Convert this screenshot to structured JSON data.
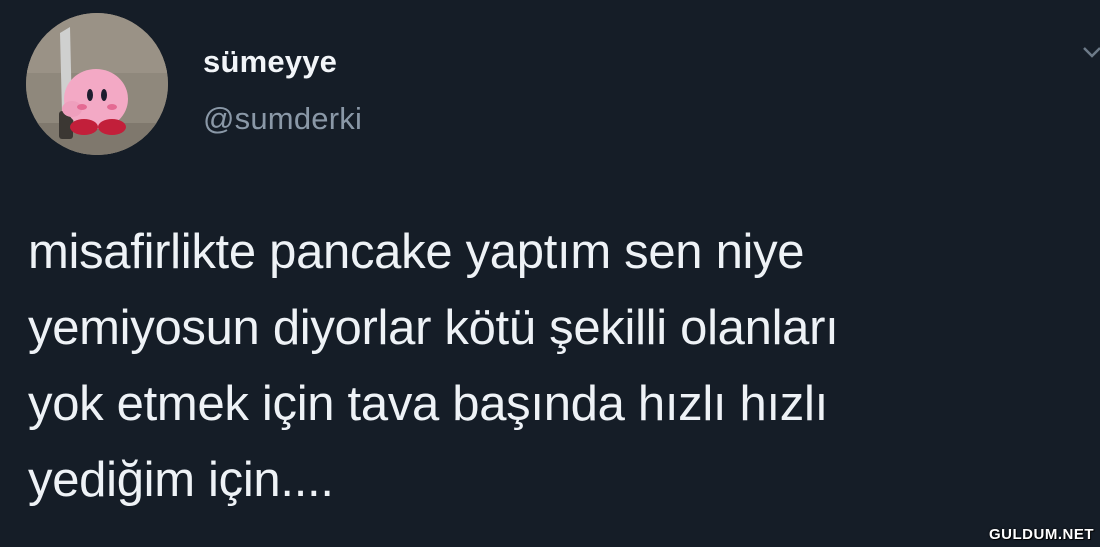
{
  "tweet": {
    "display_name": "sümeyye",
    "handle": "@sumderki",
    "text": "misafirlikte pancake yaptım sen niye\nyemiyosun diyorlar kötü şekilli olanları\nyok etmek için tava başında hızlı hızlı\nyediğim için...."
  },
  "avatar": {
    "description_icon": "kirby-plush-knife-avatar"
  },
  "watermark": {
    "text": "GULDUM.NET"
  },
  "colors": {
    "background": "#151d27",
    "text": "#eef2f6",
    "handle": "#8a98a7"
  }
}
